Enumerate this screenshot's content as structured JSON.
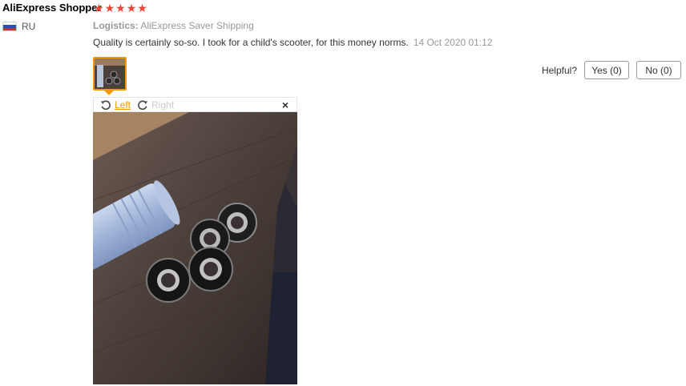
{
  "review": {
    "user_name": "AliExpress Shopper",
    "rating": 5,
    "country_code": "RU",
    "logistics_label": "Logistics:",
    "logistics_value": "AliExpress Saver Shipping",
    "text": "Quality is certainly so-so. I took for a child's scooter, for this money norms.",
    "date": "14 Oct 2020 01:12"
  },
  "helpful": {
    "label": "Helpful?",
    "yes_label": "Yes (0)",
    "no_label": "No (0)"
  },
  "viewer": {
    "rotate_left_label": "Left",
    "rotate_right_label": "Right",
    "close_label": "×"
  },
  "colors": {
    "star": "#f44336",
    "accent": "#f29900"
  }
}
